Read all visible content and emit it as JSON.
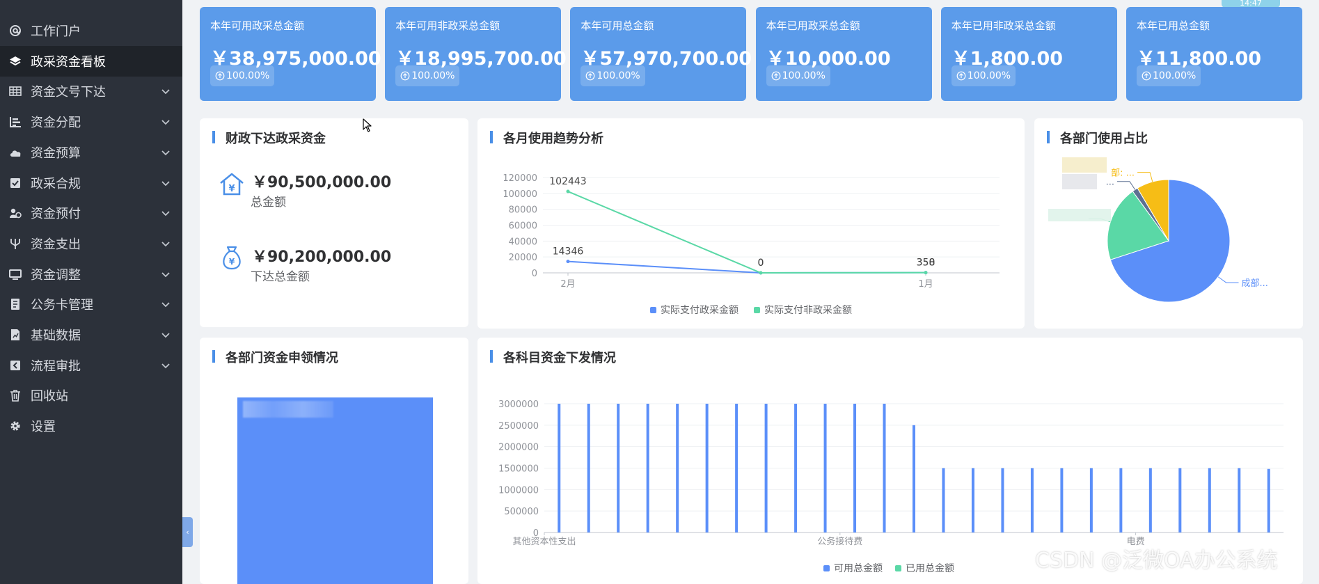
{
  "sidebar": {
    "items": [
      {
        "label": "工作门户",
        "icon": "at-icon",
        "has_chevron": false,
        "active": false
      },
      {
        "label": "政采资金看板",
        "icon": "layers-icon",
        "has_chevron": false,
        "active": true
      },
      {
        "label": "资金文号下达",
        "icon": "table-icon",
        "has_chevron": true,
        "active": false
      },
      {
        "label": "资金分配",
        "icon": "bar-align-icon",
        "has_chevron": true,
        "active": false
      },
      {
        "label": "资金预算",
        "icon": "cloud-icon",
        "has_chevron": true,
        "active": false
      },
      {
        "label": "政采合规",
        "icon": "check-square-icon",
        "has_chevron": true,
        "active": false
      },
      {
        "label": "资金预付",
        "icon": "user-coin-icon",
        "has_chevron": true,
        "active": false
      },
      {
        "label": "资金支出",
        "icon": "fork-icon",
        "has_chevron": true,
        "active": false
      },
      {
        "label": "资金调整",
        "icon": "monitor-icon",
        "has_chevron": true,
        "active": false
      },
      {
        "label": "公务卡管理",
        "icon": "card-doc-icon",
        "has_chevron": true,
        "active": false
      },
      {
        "label": "基础数据",
        "icon": "chart-doc-icon",
        "has_chevron": true,
        "active": false
      },
      {
        "label": "流程审批",
        "icon": "back-square-icon",
        "has_chevron": true,
        "active": false
      },
      {
        "label": "回收站",
        "icon": "trash-icon",
        "has_chevron": false,
        "active": false
      },
      {
        "label": "设置",
        "icon": "gear-icon",
        "has_chevron": false,
        "active": false
      }
    ],
    "collapse_label": "‹"
  },
  "time_chip": "14:47",
  "stat_cards": [
    {
      "title": "本年可用政采总金额",
      "amount": "￥38,975,000.00",
      "pct": "100.00%"
    },
    {
      "title": "本年可用非政采总金额",
      "amount": "￥18,995,700.00",
      "pct": "100.00%"
    },
    {
      "title": "本年可用总金额",
      "amount": "￥57,970,700.00",
      "pct": "100.00%"
    },
    {
      "title": "本年已用政采总金额",
      "amount": "￥10,000.00",
      "pct": "100.00%"
    },
    {
      "title": "本年已用非政采总金额",
      "amount": "￥1,800.00",
      "pct": "100.00%"
    },
    {
      "title": "本年已用总金额",
      "amount": "￥11,800.00",
      "pct": "100.00%"
    }
  ],
  "finance_panel": {
    "title": "财政下达政采资金",
    "total_amount": "￥90,500,000.00",
    "total_label": "总金额",
    "issued_amount": "￥90,200,000.00",
    "issued_label": "下达总金额"
  },
  "dept_apply_panel": {
    "title": "各部门资金申领情况"
  },
  "colors": {
    "blue": "#5b8ff9",
    "green": "#5ad8a6",
    "dark": "#5d7092",
    "yellow": "#f6bd16",
    "card": "#5b9bea"
  },
  "chart_data": [
    {
      "type": "line",
      "title": "各月使用趋势分析",
      "categories": [
        "2月",
        "1月"
      ],
      "x": [
        "2月",
        "",
        "",
        "",
        "1月"
      ],
      "yticks": [
        "0",
        "20000",
        "40000",
        "60000",
        "80000",
        "100000",
        "120000"
      ],
      "ylim": [
        0,
        120000
      ],
      "series": [
        {
          "name": "实际支付政采金额",
          "values": [
            14346,
            0,
            358
          ],
          "labels": [
            "14346",
            "0",
            "358"
          ],
          "color": "#5b8ff9"
        },
        {
          "name": "实际支付非政采金额",
          "values": [
            102443,
            0,
            350
          ],
          "labels": [
            "102443",
            "0",
            "350"
          ],
          "color": "#5ad8a6"
        }
      ],
      "legend": "bottom",
      "grid": true
    },
    {
      "type": "pie",
      "title": "各部门使用占比",
      "slices": [
        {
          "label": "成部...",
          "value": 70,
          "color": "#5b8ff9"
        },
        {
          "label": "",
          "value": 20,
          "color": "#5ad8a6"
        },
        {
          "label": "...",
          "value": 1.5,
          "color": "#5d7092"
        },
        {
          "label": "部: ...",
          "value": 8.5,
          "color": "#f6bd16"
        }
      ]
    },
    {
      "type": "bar",
      "title": "各科目资金下发情况",
      "xticks": [
        "其他资本性支出",
        "公务接待费",
        "电费"
      ],
      "yticks": [
        "0",
        "500000",
        "1000000",
        "1500000",
        "2000000",
        "2500000",
        "3000000"
      ],
      "ylim": [
        0,
        3000000
      ],
      "series": [
        {
          "name": "可用总金额",
          "color": "#5b8ff9",
          "values": [
            3000000,
            3000000,
            3000000,
            3000000,
            3000000,
            3000000,
            3000000,
            3000000,
            3000000,
            3000000,
            3000000,
            3000000,
            2500000,
            1500000,
            1500000,
            1500000,
            1500000,
            1500000,
            1500000,
            1500000,
            1500000,
            1500000,
            1500000,
            1500000,
            1480000
          ]
        },
        {
          "name": "已用总金额",
          "color": "#5ad8a6",
          "values": [
            0,
            0,
            0,
            0,
            0,
            0,
            0,
            0,
            0,
            0,
            0,
            0,
            0,
            0,
            0,
            0,
            0,
            0,
            0,
            0,
            0,
            0,
            0,
            0,
            0
          ]
        }
      ],
      "legend": "bottom",
      "grid": true
    }
  ],
  "watermark": "CSDN @泛微OA办公系统"
}
